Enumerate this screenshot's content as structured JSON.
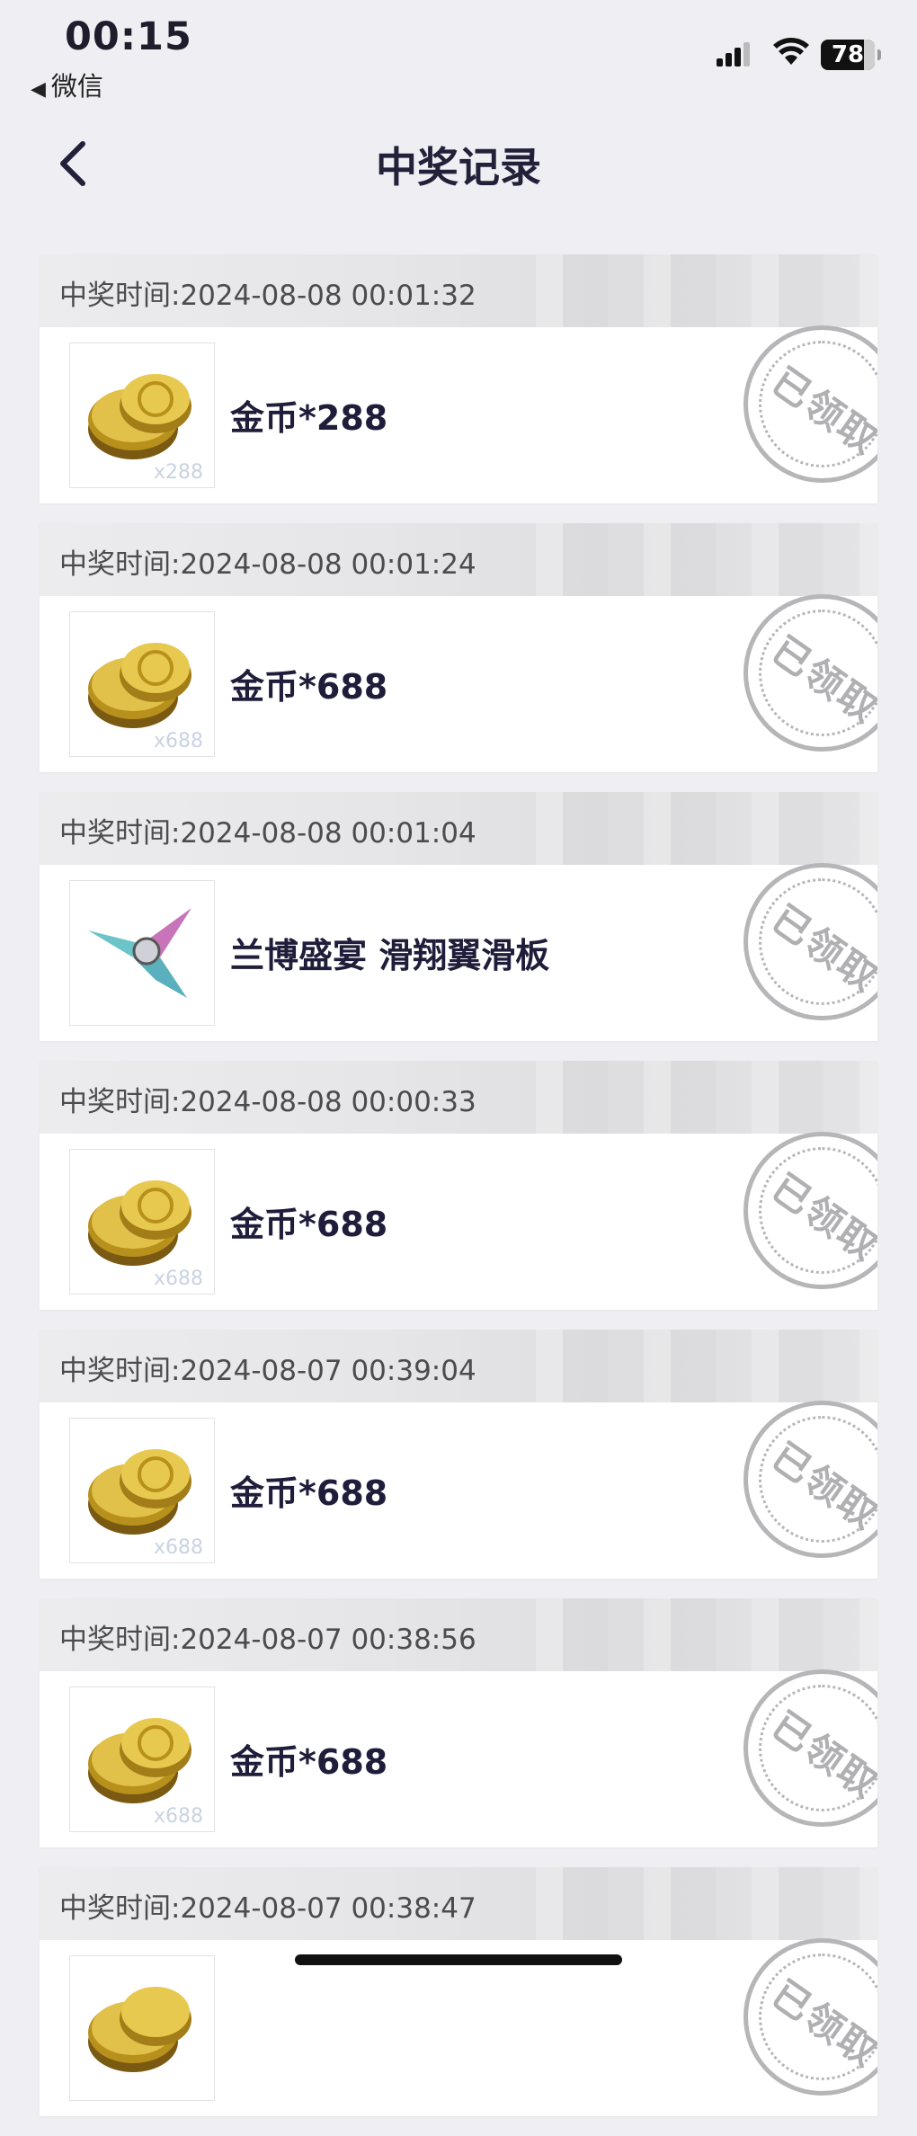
{
  "status_bar": {
    "time": "00:15",
    "back_app": "微信",
    "battery": "78"
  },
  "header": {
    "title": "中奖记录"
  },
  "records": [
    {
      "time": "中奖时间:2024-08-08 00:01:32",
      "prize": "金币*288",
      "qty": "x288",
      "icon": "gold-coins-icon",
      "status": "已领取"
    },
    {
      "time": "中奖时间:2024-08-08 00:01:24",
      "prize": "金币*688",
      "qty": "x688",
      "icon": "gold-coins-icon",
      "status": "已领取"
    },
    {
      "time": "中奖时间:2024-08-08 00:01:04",
      "prize": "兰博盛宴 滑翔翼滑板",
      "qty": "",
      "icon": "glider-icon",
      "status": "已领取"
    },
    {
      "time": "中奖时间:2024-08-08 00:00:33",
      "prize": "金币*688",
      "qty": "x688",
      "icon": "gold-coins-icon",
      "status": "已领取"
    },
    {
      "time": "中奖时间:2024-08-07 00:39:04",
      "prize": "金币*688",
      "qty": "x688",
      "icon": "gold-coins-icon",
      "status": "已领取"
    },
    {
      "time": "中奖时间:2024-08-07 00:38:56",
      "prize": "金币*688",
      "qty": "x688",
      "icon": "gold-coins-icon",
      "status": "已领取"
    },
    {
      "time": "中奖时间:2024-08-07 00:38:47",
      "prize": "",
      "qty": "",
      "icon": "gold-coins-icon",
      "status": "已领取"
    }
  ]
}
